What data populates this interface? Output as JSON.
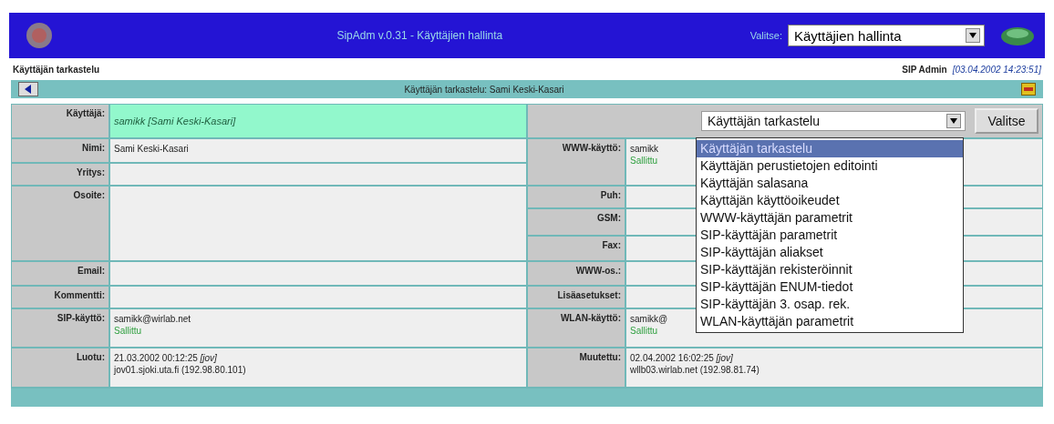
{
  "header": {
    "title": "SipAdm v.0.31 - Käyttäjien hallinta",
    "select_label": "Valitse:",
    "select_value": "Käyttäjien hallinta"
  },
  "subheader": {
    "page": "Käyttäjän tarkastelu",
    "user": "SIP Admin",
    "time": "[03.04.2002 14:23:51]"
  },
  "titlebar": {
    "title": "Käyttäjän tarkastelu:  Sami Keski-Kasari"
  },
  "user_row": {
    "label": "Käyttäjä:",
    "value": "samikk [Sami Keski-Kasari]"
  },
  "action": {
    "select_value": "Käyttäjän tarkastelu",
    "button": "Valitse",
    "options": [
      {
        "label": "Käyttäjän tarkastelu",
        "selected": true
      },
      {
        "label": "Käyttäjän perustietojen editointi",
        "selected": false
      },
      {
        "label": "Käyttäjän salasana",
        "selected": false
      },
      {
        "label": "Käyttäjän käyttöoikeudet",
        "selected": false
      },
      {
        "label": "WWW-käyttäjän parametrit",
        "selected": false
      },
      {
        "label": "SIP-käyttäjän parametrit",
        "selected": false
      },
      {
        "label": "SIP-käyttäjän aliakset",
        "selected": false
      },
      {
        "label": "SIP-käyttäjän rekisteröinnit",
        "selected": false
      },
      {
        "label": "SIP-käyttäjän ENUM-tiedot",
        "selected": false
      },
      {
        "label": "SIP-käyttäjän 3. osap. rek.",
        "selected": false
      },
      {
        "label": "WLAN-käyttäjän parametrit",
        "selected": false
      }
    ]
  },
  "left_fields": [
    {
      "label": "Nimi:",
      "lines": [
        "Sami Keski-Kasari"
      ]
    },
    {
      "label": "Yritys:"
    },
    {
      "label": "Osoite:"
    },
    {
      "label": "Email:"
    },
    {
      "label": "Kommentti:"
    },
    {
      "label": "SIP-käyttö:",
      "lines": [
        "samikk@wirlab.net"
      ],
      "status": "Sallittu"
    },
    {
      "label": "Luotu:",
      "lines": [
        "21.03.2002 00:12:25 *[jov]*",
        "jov01.sjoki.uta.fi (192.98.80.101)"
      ]
    }
  ],
  "right_fields": [
    {
      "label": "WWW-käyttö:",
      "lines": [
        "samikk"
      ],
      "status": "Sallittu"
    },
    {
      "label": "Puh:"
    },
    {
      "label": "GSM:"
    },
    {
      "label": "Fax:"
    },
    {
      "label": "WWW-os.:"
    },
    {
      "label": "Lisäasetukset:"
    },
    {
      "label": "WLAN-käyttö:",
      "lines": [
        "samikk@"
      ],
      "status": "Sallittu"
    },
    {
      "label": "Muutettu:",
      "lines": [
        "02.04.2002 16:02:25 *[jov]*",
        "wllb03.wirlab.net (192.98.81.74)"
      ]
    }
  ]
}
